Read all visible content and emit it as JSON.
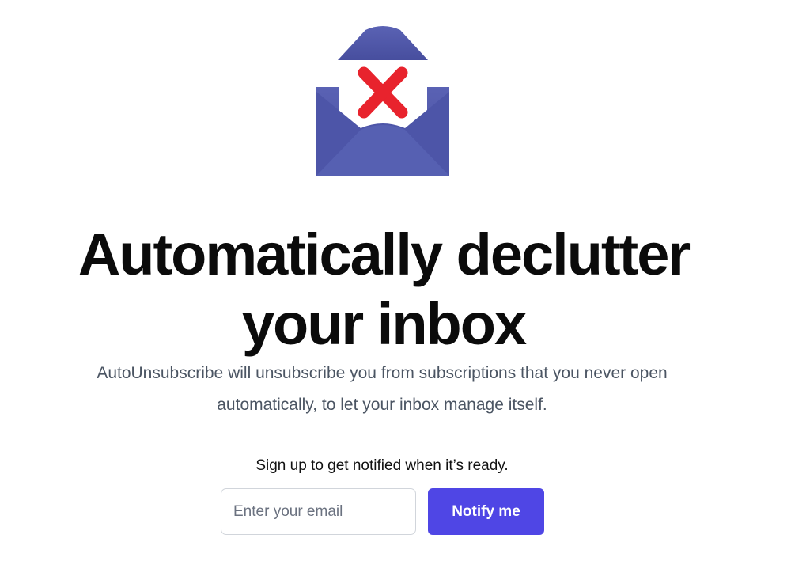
{
  "logo": {
    "icon": "envelope-unsubscribe-icon",
    "envelope_color": "#5158a8",
    "x_color": "#e8232d"
  },
  "hero": {
    "headline_line1": "Automatically declutter",
    "headline_line2": "your inbox",
    "subtitle_line1": "AutoUnsubscribe will unsubscribe you from subscriptions that you never open",
    "subtitle_line2": "automatically, to let your inbox manage itself."
  },
  "signup": {
    "prompt": "Sign up to get notified when it’s ready.",
    "email_placeholder": "Enter your email",
    "email_value": "",
    "button_label": "Notify me",
    "button_color": "#4f46e5"
  }
}
